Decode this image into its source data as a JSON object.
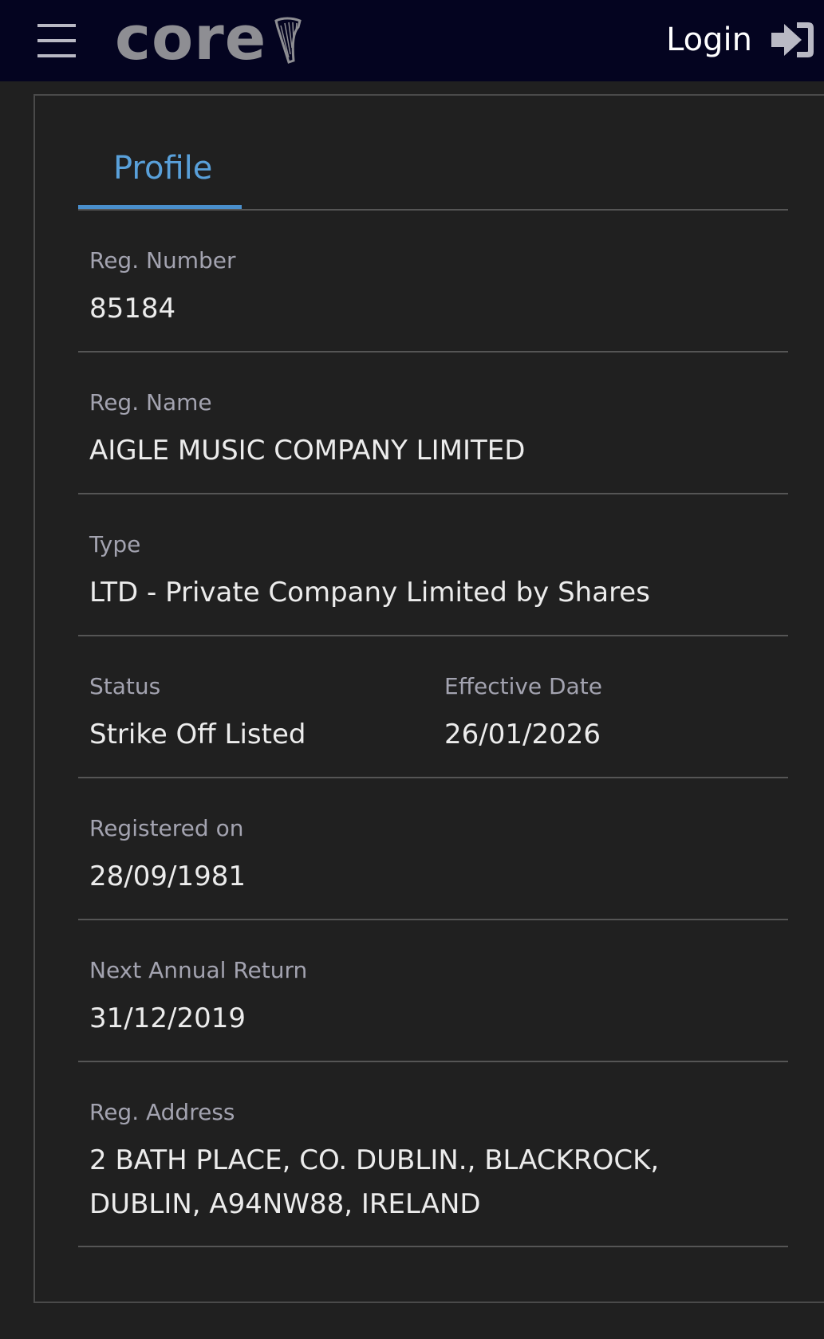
{
  "header": {
    "logo_text": "core",
    "login_label": "Login",
    "background_color": "#040420"
  },
  "tabs": [
    {
      "label": "Profile",
      "active": true,
      "accent_color": "#4a8fcc"
    }
  ],
  "profile": {
    "reg_number": {
      "label": "Reg. Number",
      "value": "85184"
    },
    "reg_name": {
      "label": "Reg. Name",
      "value": "AIGLE MUSIC COMPANY LIMITED"
    },
    "type": {
      "label": "Type",
      "value": "LTD - Private Company Limited by Shares"
    },
    "status": {
      "label": "Status",
      "value": "Strike Off Listed"
    },
    "effective_date": {
      "label": "Effective Date",
      "value": "26/01/2026"
    },
    "registered_on": {
      "label": "Registered on",
      "value": "28/09/1981"
    },
    "next_annual_return": {
      "label": "Next Annual Return",
      "value": "31/12/2019"
    },
    "reg_address": {
      "label": "Reg. Address",
      "line1": "2 BATH PLACE, CO. DUBLIN., BLACKROCK,",
      "line2": "DUBLIN, A94NW88, IRELAND"
    }
  },
  "icons": {
    "menu": "hamburger-menu-icon",
    "logo_emblem": "harp-icon",
    "login": "sign-in-icon"
  }
}
